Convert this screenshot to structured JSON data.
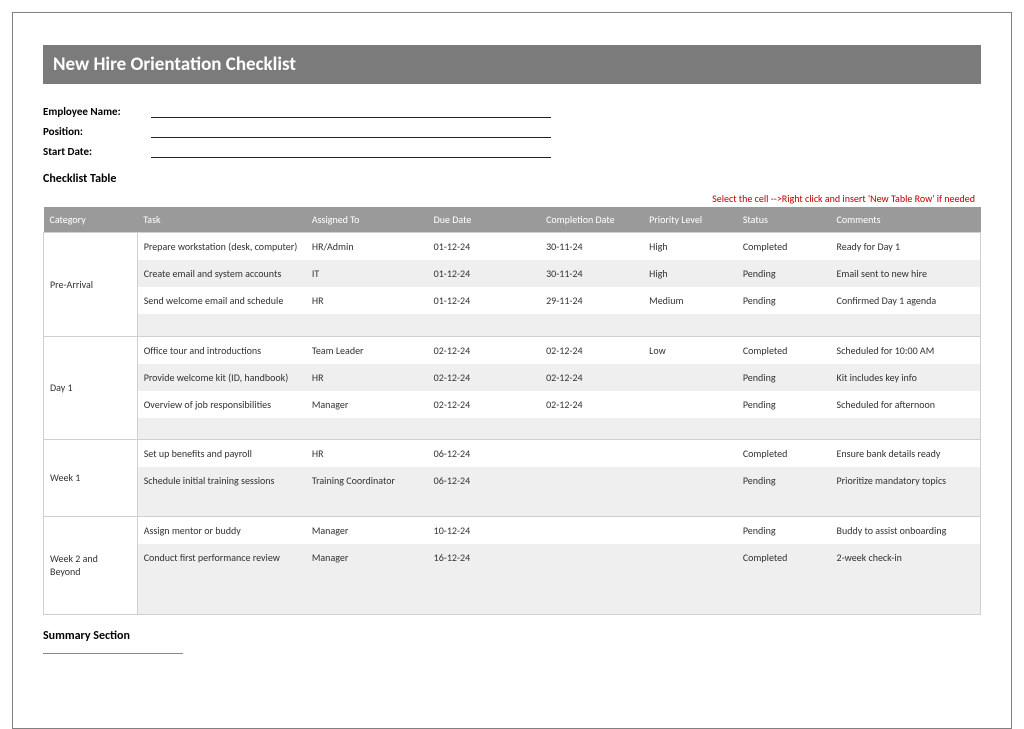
{
  "title": "New Hire Orientation Checklist",
  "meta": {
    "employee_name_label": "Employee Name:",
    "position_label": "Position:",
    "start_date_label": "Start Date:"
  },
  "checklist_title": "Checklist Table",
  "hint": "Select the cell -->Right click and insert 'New Table Row' if needed",
  "columns": {
    "category": "Category",
    "task": "Task",
    "assigned": "Assigned To",
    "due": "Due Date",
    "completion": "Completion Date",
    "priority": "Priority Level",
    "status": "Status",
    "comments": "Comments"
  },
  "groups": [
    {
      "category": "Pre-Arrival",
      "rows": [
        {
          "task": "Prepare workstation (desk, computer)",
          "assigned": "HR/Admin",
          "due": "01-12-24",
          "completion": "30-11-24",
          "priority": "High",
          "status": "Completed",
          "comments": "Ready for Day 1"
        },
        {
          "task": "Create email and system accounts",
          "assigned": "IT",
          "due": "01-12-24",
          "completion": "30-11-24",
          "priority": "High",
          "status": "Pending",
          "comments": "Email sent to new hire"
        },
        {
          "task": "Send welcome email and schedule",
          "assigned": "HR",
          "due": "01-12-24",
          "completion": "29-11-24",
          "priority": "Medium",
          "status": "Pending",
          "comments": "Confirmed Day 1 agenda"
        }
      ],
      "empty_rows": 1
    },
    {
      "category": "Day 1",
      "rows": [
        {
          "task": "Office tour and introductions",
          "assigned": "Team Leader",
          "due": "02-12-24",
          "completion": "02-12-24",
          "priority": "Low",
          "status": "Completed",
          "comments": "Scheduled for 10:00 AM"
        },
        {
          "task": "Provide welcome kit (ID, handbook)",
          "assigned": "HR",
          "due": "02-12-24",
          "completion": "02-12-24",
          "priority": "",
          "status": "Pending",
          "comments": "Kit includes key info"
        },
        {
          "task": "Overview of job responsibilities",
          "assigned": "Manager",
          "due": "02-12-24",
          "completion": "02-12-24",
          "priority": "",
          "status": "Pending",
          "comments": "Scheduled for afternoon"
        }
      ],
      "empty_rows": 1
    },
    {
      "category": "Week 1",
      "rows": [
        {
          "task": "Set up benefits and payroll",
          "assigned": "HR",
          "due": "06-12-24",
          "completion": "",
          "priority": "",
          "status": "Completed",
          "comments": "Ensure bank details ready"
        },
        {
          "task": "Schedule initial training sessions",
          "assigned": "Training Coordinator",
          "due": "06-12-24",
          "completion": "",
          "priority": "",
          "status": "Pending",
          "comments": "Prioritize mandatory topics"
        }
      ],
      "empty_rows": 1
    },
    {
      "category": "Week 2 and Beyond",
      "rows": [
        {
          "task": "Assign mentor or buddy",
          "assigned": "Manager",
          "due": "10-12-24",
          "completion": "",
          "priority": "",
          "status": "Pending",
          "comments": "Buddy to assist onboarding"
        },
        {
          "task": "Conduct first performance review",
          "assigned": "Manager",
          "due": "16-12-24",
          "completion": "",
          "priority": "",
          "status": "Completed",
          "comments": "2-week check-in"
        }
      ],
      "empty_rows": 2
    }
  ],
  "summary_title": "Summary Section"
}
